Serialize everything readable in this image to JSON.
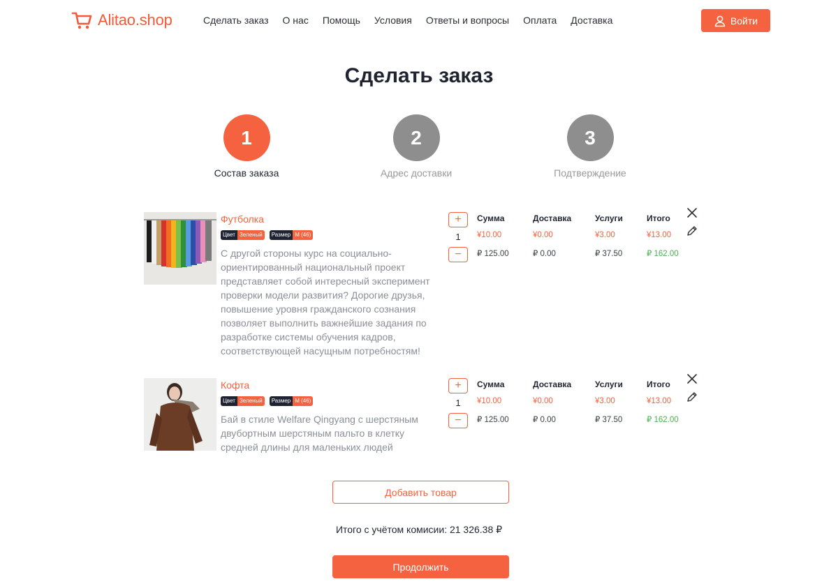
{
  "header": {
    "logo_text": "Alitao.shop",
    "nav": [
      "Сделать заказ",
      "О нас",
      "Помощь",
      "Условия",
      "Ответы и вопросы",
      "Оплата",
      "Доставка"
    ],
    "login_label": "Войти"
  },
  "page_title": "Сделать заказ",
  "steps": [
    {
      "number": "1",
      "label": "Состав заказа",
      "active": true
    },
    {
      "number": "2",
      "label": "Адрес доставки",
      "active": false
    },
    {
      "number": "3",
      "label": "Подтверждение",
      "active": false
    }
  ],
  "price_headers": {
    "sum": "Сумма",
    "delivery": "Доставка",
    "services": "Услуги",
    "total": "Итого"
  },
  "items": [
    {
      "name": "Футболка",
      "tags": [
        {
          "key": "Цвет",
          "value": "Зеленый"
        },
        {
          "key": "Размер",
          "value": "М (46)"
        }
      ],
      "description": "С другой стороны курс на социально-ориентированный национальный проект представляет собой интересный эксперимент проверки модели развития? Дорогие друзья, повышение уровня гражданского сознания позволяет выполнить важнейшие задания по разработке системы обучения кадров, соответствующей насущным потребностям!",
      "quantity": "1",
      "prices_cny": {
        "sum": "¥10.00",
        "delivery": "¥0.00",
        "services": "¥3.00",
        "total": "¥13.00"
      },
      "prices_rub": {
        "sum": "₽ 125.00",
        "delivery": "₽ 0.00",
        "services": "₽ 37.50",
        "total": "₽ 162.00"
      }
    },
    {
      "name": "Кофта",
      "tags": [
        {
          "key": "Цвет",
          "value": "Зеленый"
        },
        {
          "key": "Размер",
          "value": "М (46)"
        }
      ],
      "description": "Бай в стиле Welfare Qingyang с шерстяным двубортным шерстяным пальто в клетку средней длины для маленьких людей",
      "quantity": "1",
      "prices_cny": {
        "sum": "¥10.00",
        "delivery": "¥0.00",
        "services": "¥3.00",
        "total": "¥13.00"
      },
      "prices_rub": {
        "sum": "₽ 125.00",
        "delivery": "₽ 0.00",
        "services": "₽ 37.50",
        "total": "₽ 162.00"
      }
    }
  ],
  "add_item_label": "Добавить товар",
  "total_label": "Итого с учётом комисии: 21 326.38 ₽",
  "continue_label": "Продолжить",
  "icons": {
    "logo": "cart-icon",
    "login": "user-icon",
    "qty_plus": "plus-icon",
    "qty_minus": "minus-icon",
    "remove": "close-icon",
    "edit": "pencil-icon"
  },
  "colors": {
    "accent": "#f4623f",
    "dark": "#1d2330",
    "green": "#4caf50",
    "muted": "#8a8f98",
    "step_inactive": "#8e8e8e"
  }
}
